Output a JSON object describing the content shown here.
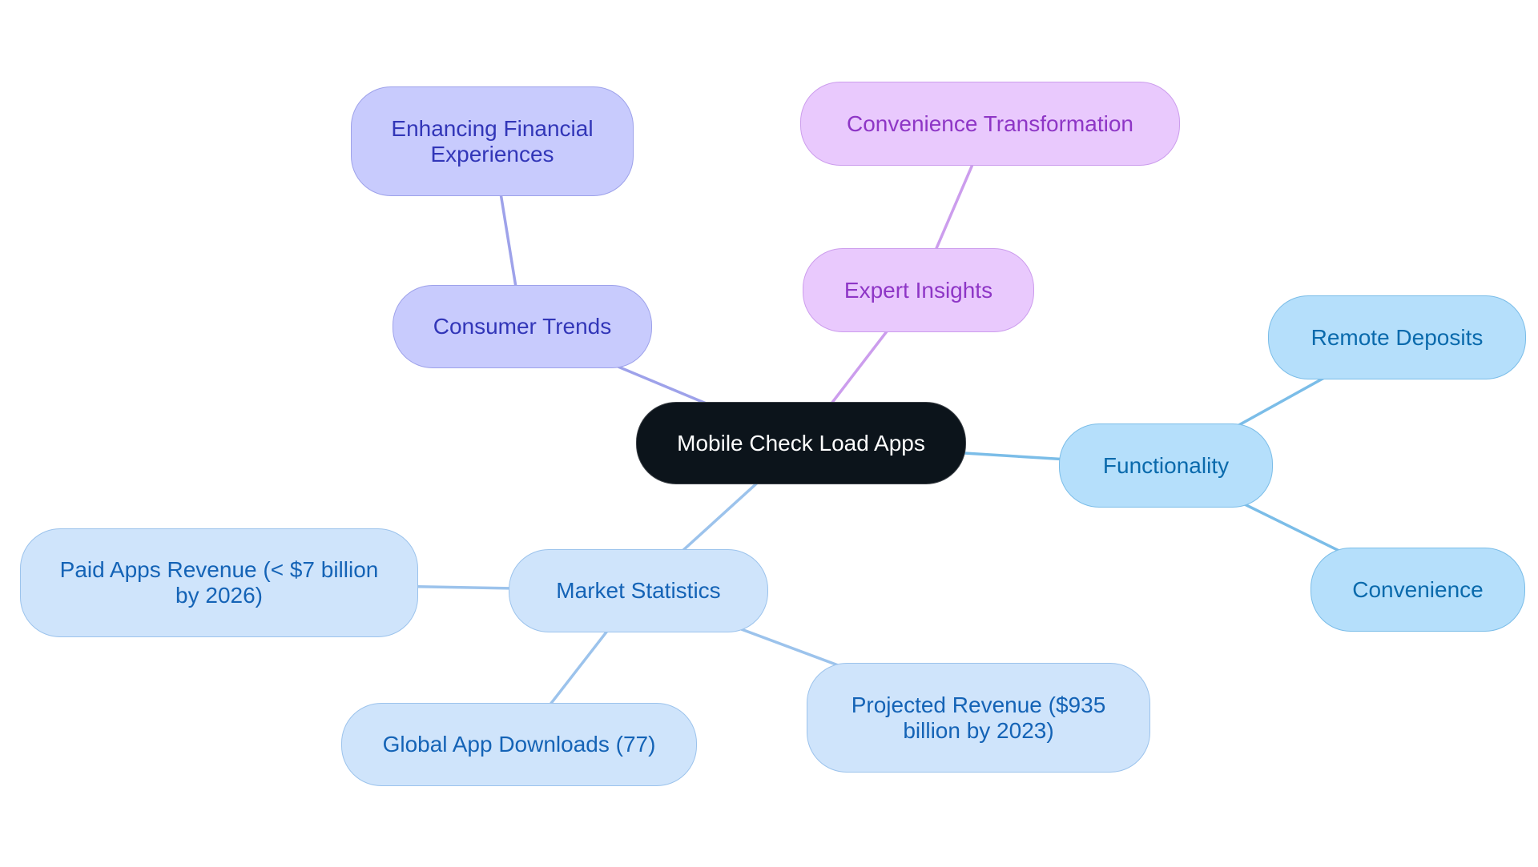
{
  "diagram": {
    "type": "mind-map",
    "root": {
      "id": "root",
      "label": "Mobile Check Load Apps"
    },
    "nodes": [
      {
        "id": "consumer-trends",
        "label": "Consumer Trends",
        "parent": "root",
        "theme": "indigo"
      },
      {
        "id": "enhancing-financial-experiences",
        "label": "Enhancing Financial Experiences",
        "parent": "consumer-trends",
        "theme": "indigo"
      },
      {
        "id": "expert-insights",
        "label": "Expert Insights",
        "parent": "root",
        "theme": "violet"
      },
      {
        "id": "convenience-transformation",
        "label": "Convenience Transformation",
        "parent": "expert-insights",
        "theme": "violet"
      },
      {
        "id": "functionality",
        "label": "Functionality",
        "parent": "root",
        "theme": "sky"
      },
      {
        "id": "remote-deposits",
        "label": "Remote Deposits",
        "parent": "functionality",
        "theme": "sky"
      },
      {
        "id": "convenience",
        "label": "Convenience",
        "parent": "functionality",
        "theme": "sky"
      },
      {
        "id": "market-statistics",
        "label": "Market Statistics",
        "parent": "root",
        "theme": "pale"
      },
      {
        "id": "paid-apps-revenue",
        "label": "Paid Apps Revenue (< $7 billion by 2026)",
        "parent": "market-statistics",
        "theme": "pale"
      },
      {
        "id": "global-app-downloads",
        "label": "Global App Downloads (77)",
        "parent": "market-statistics",
        "theme": "pale"
      },
      {
        "id": "projected-revenue",
        "label": "Projected Revenue ($935 billion by 2023)",
        "parent": "market-statistics",
        "theme": "pale"
      }
    ],
    "colors": {
      "root_fill": "#0c141b",
      "root_text": "#ffffff",
      "indigo_fill": "#c8cbfd",
      "indigo_text": "#3236b8",
      "indigo_edge": "#9ea2ea",
      "violet_fill": "#e9c9fd",
      "violet_text": "#8e36c6",
      "violet_edge": "#cc9ded",
      "sky_fill": "#b5dffb",
      "sky_text": "#0a6aac",
      "sky_edge": "#7bbde8",
      "pale_fill": "#cfe4fb",
      "pale_text": "#1463b6",
      "pale_edge": "#9cc3ec"
    }
  }
}
